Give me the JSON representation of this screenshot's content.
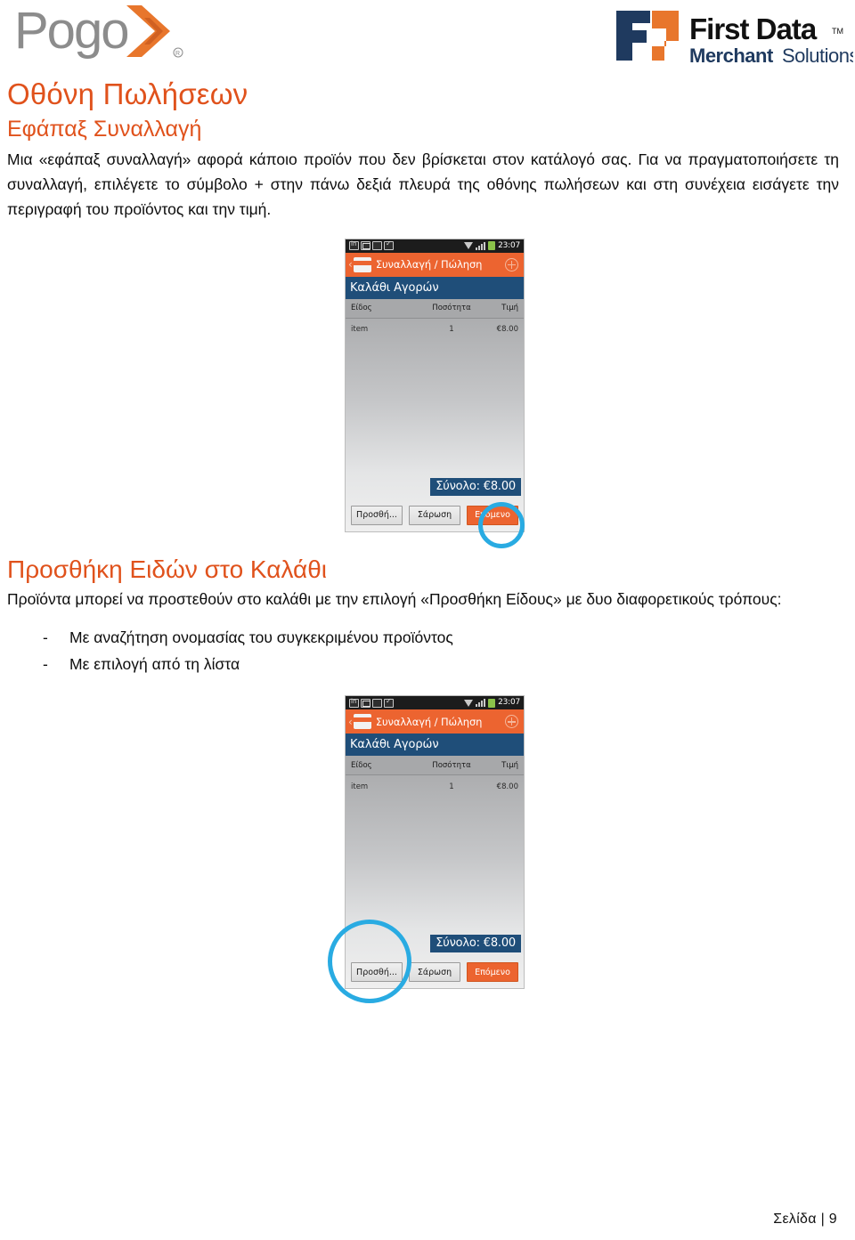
{
  "header": {
    "pogo_logo_text": "Pogo",
    "pogo_registered": "®",
    "firstdata_title": "First Data",
    "firstdata_tm": "™",
    "firstdata_sub_bold": "Merchant",
    "firstdata_sub_light": "Solutions",
    "brand_orange": "#EC6430",
    "brand_navy": "#1F4E79",
    "pogo_gray": "#8c8c8c"
  },
  "page": {
    "title": "Οθόνη Πωλήσεων",
    "subtitle": "Εφάπαξ Συναλλαγή",
    "paragraph": "Μια «εφάπαξ συναλλαγή» αφορά κάποιο προϊόν που δεν βρίσκεται στον κατάλογό σας. Για να πραγματοποιήσετε τη συναλλαγή, επιλέγετε το σύμβολο + στην πάνω δεξιά πλευρά της οθόνης πωλήσεων και στη συνέχεια εισάγετε την περιγραφή του προϊόντος και την τιμή.",
    "section2_title": "Προσθήκη Ειδών στο Καλάθι",
    "section2_paragraph": "Προϊόντα μπορεί να προστεθούν στο καλάθι με την επιλογή «Προσθήκη Είδους» με δυο διαφορετικούς τρόπους:",
    "bullets": [
      {
        "dash": "-",
        "text": "Με αναζήτηση ονομασίας του συγκεκριμένου προϊόντος"
      },
      {
        "dash": "-",
        "text": "Με επιλογή από τη λίστα"
      }
    ]
  },
  "phone1": {
    "statusbar": {
      "icons": [
        "linkedin-icon",
        "mail-icon",
        "device-icon",
        "checkbox-icon"
      ],
      "wifi": "wifi-icon",
      "signal": "signal-bars-icon",
      "battery": "battery-icon",
      "time": "23:07"
    },
    "actionbar": {
      "back": "‹",
      "app_icon": "pogo-app-icon",
      "title": "Συναλλαγή / Πώληση",
      "add_icon": "plus-circle-icon"
    },
    "section_title": "Καλάθι Αγορών",
    "columns": [
      "Είδος",
      "Ποσότητα",
      "Τιμή"
    ],
    "rows": [
      {
        "item": "item",
        "qty": "1",
        "price": "€8.00"
      }
    ],
    "total": "Σύνολο: €8.00",
    "buttons": [
      {
        "label": "Προσθή...",
        "primary": false
      },
      {
        "label": "Σάρωση",
        "primary": false
      },
      {
        "label": "Επόμενο",
        "primary": true
      }
    ],
    "annotation": {
      "target": "plus-circle-icon",
      "color": "#29ABE2"
    }
  },
  "phone2": {
    "statusbar": {
      "icons": [
        "linkedin-icon",
        "mail-icon",
        "device-icon",
        "checkbox-icon"
      ],
      "wifi": "wifi-icon",
      "signal": "signal-bars-icon",
      "battery": "battery-icon",
      "time": "23:07"
    },
    "actionbar": {
      "back": "‹",
      "app_icon": "pogo-app-icon",
      "title": "Συναλλαγή / Πώληση",
      "add_icon": "plus-circle-icon"
    },
    "section_title": "Καλάθι Αγορών",
    "columns": [
      "Είδος",
      "Ποσότητα",
      "Τιμή"
    ],
    "rows": [
      {
        "item": "item",
        "qty": "1",
        "price": "€8.00"
      }
    ],
    "total": "Σύνολο: €8.00",
    "buttons": [
      {
        "label": "Προσθή...",
        "primary": false
      },
      {
        "label": "Σάρωση",
        "primary": false
      },
      {
        "label": "Επόμενο",
        "primary": true
      }
    ],
    "annotation": {
      "target": "add-item-button",
      "color": "#29ABE2"
    }
  },
  "footer": {
    "page_label": "Σελίδα",
    "separator": "|",
    "page_number": "9"
  }
}
